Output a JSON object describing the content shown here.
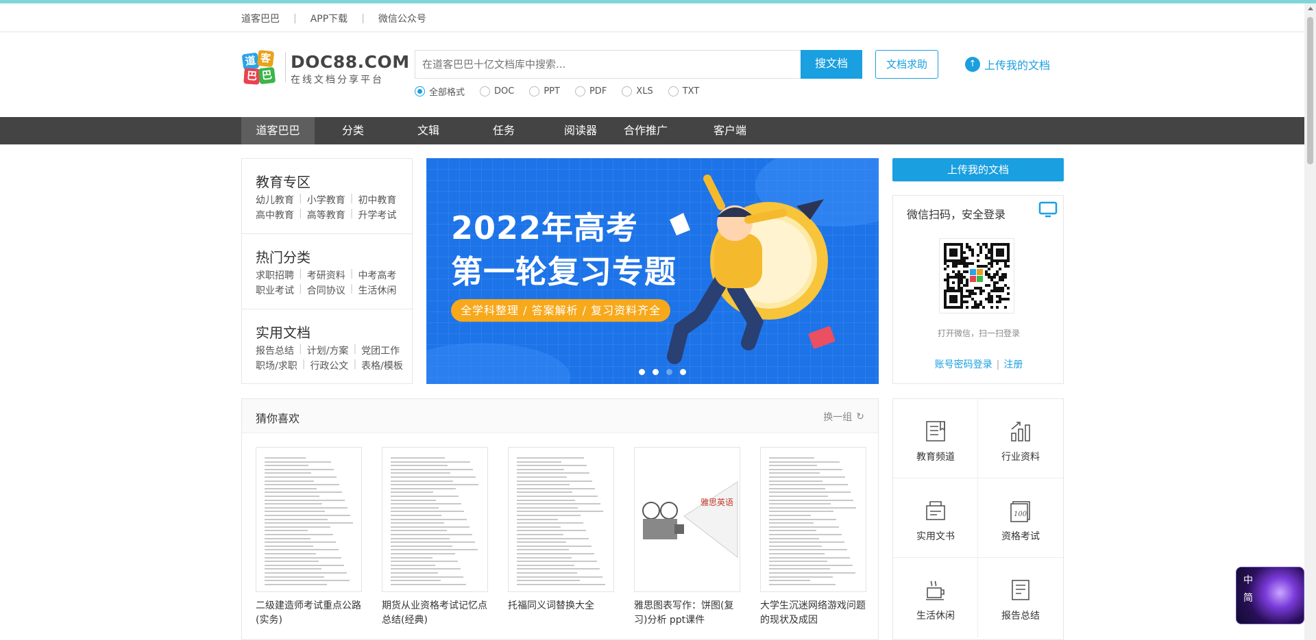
{
  "topbar": {
    "links": [
      "道客巴巴",
      "APP下载",
      "微信公众号"
    ]
  },
  "logo": {
    "chars": [
      "道",
      "客",
      "巴",
      "巴"
    ],
    "name": "DOC88.COM",
    "slogan": "在线文档分享平台"
  },
  "search": {
    "placeholder": "在道客巴巴十亿文档库中搜索...",
    "button": "搜文档",
    "request_button": "文档求助",
    "upload_link": "上传我的文档",
    "formats": [
      "全部格式",
      "DOC",
      "PPT",
      "PDF",
      "XLS",
      "TXT"
    ],
    "selected_format": "全部格式"
  },
  "nav": {
    "items": [
      "道客巴巴",
      "分类",
      "文辑",
      "任务",
      "阅读器",
      "合作推广",
      "客户端"
    ],
    "active": "道客巴巴"
  },
  "categories": [
    {
      "title": "教育专区",
      "rows": [
        [
          "幼儿教育",
          "小学教育",
          "初中教育"
        ],
        [
          "高中教育",
          "高等教育",
          "升学考试"
        ]
      ]
    },
    {
      "title": "热门分类",
      "rows": [
        [
          "求职招聘",
          "考研资料",
          "中考高考"
        ],
        [
          "职业考试",
          "合同协议",
          "生活休闲"
        ]
      ]
    },
    {
      "title": "实用文档",
      "rows": [
        [
          "报告总结",
          "计划/方案",
          "党团工作"
        ],
        [
          "职场/求职",
          "行政公文",
          "表格/模板"
        ]
      ]
    }
  ],
  "banner": {
    "line1": "2022年高考",
    "line2": "第一轮复习专题",
    "tagline": "全学科整理 / 答案解析 / 复习资料齐全",
    "slides": 4,
    "active_slide": 3
  },
  "upload_button": "上传我的文档",
  "login": {
    "title": "微信扫码，安全登录",
    "tip": "打开微信，扫一扫登录",
    "account_link": "账号密码登录",
    "register_link": "注册"
  },
  "guess": {
    "title": "猜你喜欢",
    "refresh": "换一组",
    "items": [
      {
        "title": "二级建造师考试重点公路(实务)"
      },
      {
        "title": "期货从业资格考试记忆点总结(经典)"
      },
      {
        "title": "托福同义词替换大全"
      },
      {
        "title": "雅思图表写作：饼图(复习)分析 ppt课件"
      },
      {
        "title": "大学生沉迷网络游戏问题的现状及成因"
      }
    ]
  },
  "channels": [
    {
      "label": "教育频道",
      "icon": "book-icon"
    },
    {
      "label": "行业资料",
      "icon": "chart-icon"
    },
    {
      "label": "实用文书",
      "icon": "document-icon"
    },
    {
      "label": "资格考试",
      "icon": "exam-icon"
    },
    {
      "label": "生活休闲",
      "icon": "coffee-icon"
    },
    {
      "label": "报告总结",
      "icon": "report-icon"
    }
  ],
  "widget": {
    "line1": "中",
    "line2": "简"
  },
  "colors": {
    "accent": "#1a9fe0",
    "nav_bg": "#444444",
    "banner_bg": "#1d73e8",
    "pill": "#f7a81b"
  }
}
